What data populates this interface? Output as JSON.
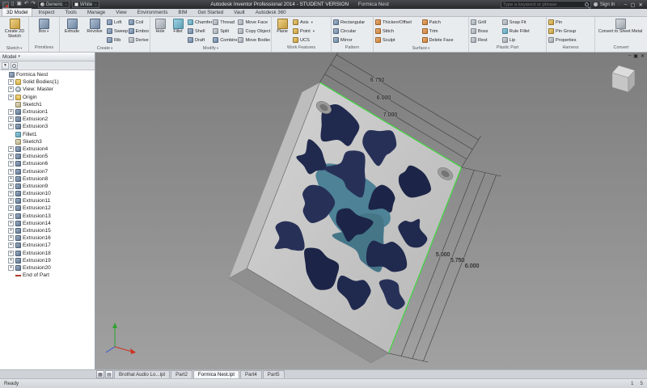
{
  "title_bar": {
    "material_dropdown": "Generic",
    "appearance_dropdown": "White",
    "app_title": "Autodesk Inventor Professional 2014 - STUDENT VERSION",
    "document_name": "Formica Nest",
    "search_placeholder": "Type a keyword or phrase",
    "sign_in_label": "Sign In"
  },
  "ribbon": {
    "tabs": [
      {
        "label": "3D Model",
        "active": true
      },
      {
        "label": "Inspect"
      },
      {
        "label": "Tools"
      },
      {
        "label": "Manage"
      },
      {
        "label": "View"
      },
      {
        "label": "Environments"
      },
      {
        "label": "BIM"
      },
      {
        "label": "Get Started"
      },
      {
        "label": "Vault"
      },
      {
        "label": "Autodesk 360"
      }
    ],
    "groups": {
      "sketch": {
        "label": "Sketch",
        "big": "Create 2D Sketch"
      },
      "primitives": {
        "label": "Primitives",
        "big": "Box"
      },
      "create": {
        "label": "Create",
        "big1": "Extrude",
        "big2": "Revolve",
        "col1": [
          "Loft",
          "Sweep",
          "Rib"
        ],
        "col2": [
          "Coil",
          "Emboss",
          "Derive"
        ]
      },
      "modify": {
        "label": "Modify",
        "big1": "Hole",
        "big2": "Fillet",
        "col1": [
          "Chamfer",
          "Shell",
          "Draft"
        ],
        "col2": [
          "Thread",
          "Split",
          "Combine"
        ],
        "col3": [
          "Move Face",
          "Copy Object",
          "Move Bodies"
        ]
      },
      "work_features": {
        "label": "Work Features",
        "big": "Plane",
        "col1": [
          "Axis",
          "Point",
          "UCS"
        ]
      },
      "pattern": {
        "label": "Pattern",
        "col1": [
          "Rectangular",
          "Circular",
          "Mirror"
        ]
      },
      "surface": {
        "label": "Surface",
        "col1": [
          "Thicken/Offset",
          "Stitch",
          "Sculpt"
        ],
        "col2": [
          "Patch",
          "Trim",
          "Delete Face"
        ]
      },
      "plastic_part": {
        "label": "Plastic Part",
        "col1": [
          "Grill",
          "Boss",
          "Rest"
        ],
        "col2": [
          "Snap Fit",
          "Rule Fillet",
          "Lip"
        ]
      },
      "harness": {
        "label": "Harness",
        "col1": [
          "Pin",
          "Pin Group",
          "Properties"
        ]
      },
      "convert": {
        "label": "Convert",
        "big": "Convert to Sheet Metal"
      }
    }
  },
  "browser": {
    "header": "Model",
    "tree": [
      {
        "label": "Formica Nest",
        "icon": "part",
        "plus": "",
        "indent": 0
      },
      {
        "label": "Solid Bodies(1)",
        "icon": "folder",
        "plus": "+",
        "indent": 1
      },
      {
        "label": "View: Master",
        "icon": "view",
        "plus": "+",
        "indent": 1
      },
      {
        "label": "Origin",
        "icon": "origin",
        "plus": "+",
        "indent": 1
      },
      {
        "label": "Sketch1",
        "icon": "sketch",
        "plus": "",
        "indent": 1
      },
      {
        "label": "Extrusion1",
        "icon": "extrusion",
        "plus": "+",
        "indent": 1
      },
      {
        "label": "Extrusion2",
        "icon": "extrusion",
        "plus": "+",
        "indent": 1
      },
      {
        "label": "Extrusion3",
        "icon": "extrusion",
        "plus": "+",
        "indent": 1
      },
      {
        "label": "Fillet1",
        "icon": "fillet",
        "plus": "",
        "indent": 1
      },
      {
        "label": "Sketch3",
        "icon": "sketch",
        "plus": "",
        "indent": 1
      },
      {
        "label": "Extrusion4",
        "icon": "extrusion",
        "plus": "+",
        "indent": 1
      },
      {
        "label": "Extrusion5",
        "icon": "extrusion",
        "plus": "+",
        "indent": 1
      },
      {
        "label": "Extrusion6",
        "icon": "extrusion",
        "plus": "+",
        "indent": 1
      },
      {
        "label": "Extrusion7",
        "icon": "extrusion",
        "plus": "+",
        "indent": 1
      },
      {
        "label": "Extrusion8",
        "icon": "extrusion",
        "plus": "+",
        "indent": 1
      },
      {
        "label": "Extrusion9",
        "icon": "extrusion",
        "plus": "+",
        "indent": 1
      },
      {
        "label": "Extrusion10",
        "icon": "extrusion",
        "plus": "+",
        "indent": 1
      },
      {
        "label": "Extrusion11",
        "icon": "extrusion",
        "plus": "+",
        "indent": 1
      },
      {
        "label": "Extrusion12",
        "icon": "extrusion",
        "plus": "+",
        "indent": 1
      },
      {
        "label": "Extrusion13",
        "icon": "extrusion",
        "plus": "+",
        "indent": 1
      },
      {
        "label": "Extrusion14",
        "icon": "extrusion",
        "plus": "+",
        "indent": 1
      },
      {
        "label": "Extrusion15",
        "icon": "extrusion",
        "plus": "+",
        "indent": 1
      },
      {
        "label": "Extrusion16",
        "icon": "extrusion",
        "plus": "+",
        "indent": 1
      },
      {
        "label": "Extrusion17",
        "icon": "extrusion",
        "plus": "+",
        "indent": 1
      },
      {
        "label": "Extrusion18",
        "icon": "extrusion",
        "plus": "+",
        "indent": 1
      },
      {
        "label": "Extrusion19",
        "icon": "extrusion",
        "plus": "+",
        "indent": 1
      },
      {
        "label": "Extrusion20",
        "icon": "extrusion",
        "plus": "+",
        "indent": 1
      },
      {
        "label": "End of Part",
        "icon": "eop",
        "plus": "",
        "indent": 1
      }
    ]
  },
  "viewport": {
    "dims_top": [
      "6.750",
      "6.000",
      "7.000"
    ],
    "dims_right": [
      "5.000",
      "5.750",
      "6.000"
    ]
  },
  "document_tabs": [
    {
      "label": "Brothal Audio Lo...ipt"
    },
    {
      "label": "Part2"
    },
    {
      "label": "Formica Nest.ipt",
      "active": true
    },
    {
      "label": "Part4"
    },
    {
      "label": "Part5"
    }
  ],
  "status_bar": {
    "message": "Ready",
    "right_a": "1",
    "right_b": "5"
  }
}
